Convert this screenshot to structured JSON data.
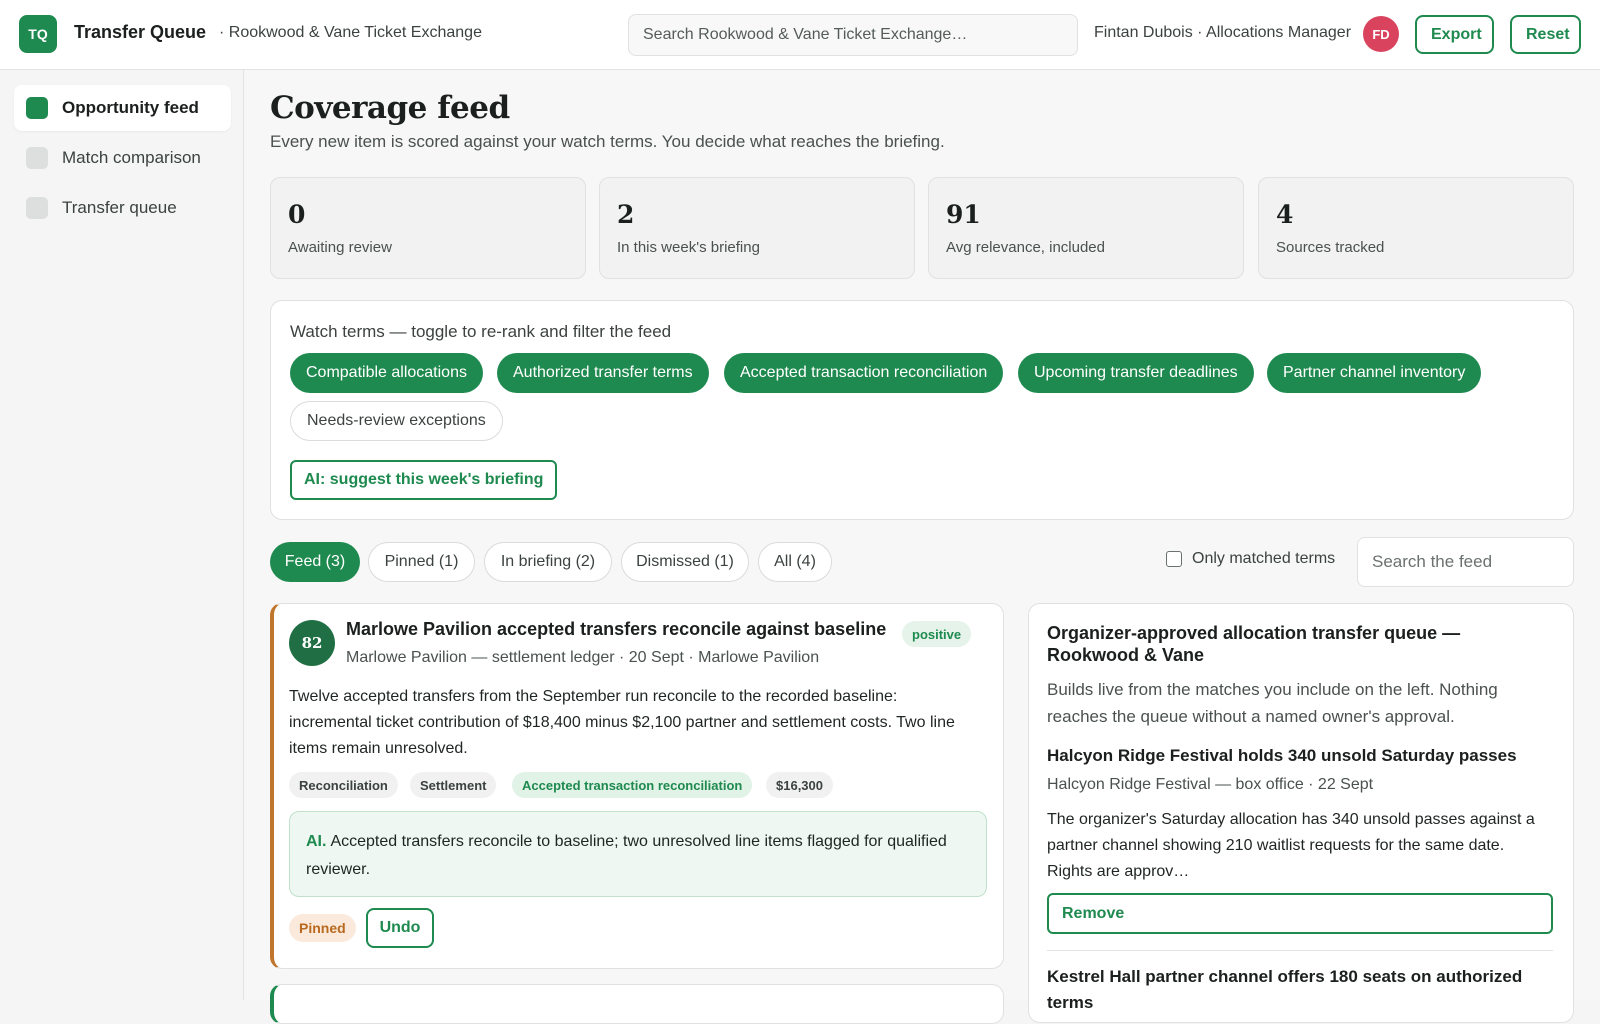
{
  "header": {
    "logo_text": "TQ",
    "app_title": "Transfer Queue",
    "org_name": "· Rookwood & Vane Ticket Exchange",
    "search_placeholder": "Search Rookwood & Vane Ticket Exchange…",
    "user_label": "Fintan Dubois · Allocations Manager",
    "avatar_initials": "FD",
    "export_label": "Export",
    "reset_label": "Reset"
  },
  "sidebar": {
    "items": [
      {
        "label": "Opportunity feed",
        "active": true
      },
      {
        "label": "Match comparison",
        "active": false
      },
      {
        "label": "Transfer queue",
        "active": false
      }
    ]
  },
  "page": {
    "title": "Coverage feed",
    "subtitle": "Every new item is scored against your watch terms. You decide what reaches the briefing."
  },
  "stats": [
    {
      "value": "0",
      "label": "Awaiting review"
    },
    {
      "value": "2",
      "label": "In this week's briefing"
    },
    {
      "value": "91",
      "label": "Avg relevance, included"
    },
    {
      "value": "4",
      "label": "Sources tracked"
    }
  ],
  "watch_terms": {
    "heading": "Watch terms — toggle to re-rank and filter the feed",
    "chips": [
      {
        "label": "Compatible allocations",
        "on": true
      },
      {
        "label": "Authorized transfer terms",
        "on": true
      },
      {
        "label": "Accepted transaction reconciliation",
        "on": true
      },
      {
        "label": "Upcoming transfer deadlines",
        "on": true
      },
      {
        "label": "Partner channel inventory",
        "on": true
      },
      {
        "label": "Needs-review exceptions",
        "on": false
      }
    ],
    "ai_suggest_label": "AI: suggest this week's briefing"
  },
  "tabs": [
    {
      "label": "Feed (3)",
      "active": true
    },
    {
      "label": "Pinned (1)",
      "active": false
    },
    {
      "label": "In briefing (2)",
      "active": false
    },
    {
      "label": "Dismissed (1)",
      "active": false
    },
    {
      "label": "All (4)",
      "active": false
    }
  ],
  "filters": {
    "only_matched_label": "Only matched terms",
    "only_matched_checked": false,
    "feed_search_placeholder": "Search the feed"
  },
  "feed_card": {
    "score": "82",
    "title": "Marlowe Pavilion accepted transfers reconcile against baseline",
    "sentiment": "positive",
    "meta": "Marlowe Pavilion — settlement ledger · 20 Sept · Marlowe Pavilion",
    "body": "Twelve accepted transfers from the September run reconcile to the recorded baseline: incremental ticket contribution of $18,400 minus $2,100 partner and settlement costs. Two line items remain unresolved.",
    "tags": [
      {
        "label": "Reconciliation",
        "match": false
      },
      {
        "label": "Settlement",
        "match": false
      },
      {
        "label": "Accepted transaction reconciliation",
        "match": true
      },
      {
        "label": "$16,300",
        "match": false
      }
    ],
    "ai_prefix": "AI.",
    "ai_text": "Accepted transfers reconcile to baseline; two unresolved line items flagged for qualified reviewer.",
    "pinned_label": "Pinned",
    "undo_label": "Undo",
    "accent_color": "#c0762c"
  },
  "queue_panel": {
    "title": "Organizer-approved allocation transfer queue — Rookwood & Vane",
    "description": "Builds live from the matches you include on the left. Nothing reaches the queue without a named owner's approval.",
    "items": [
      {
        "title": "Halcyon Ridge Festival holds 340 unsold Saturday passes",
        "meta": "Halcyon Ridge Festival — box office · 22 Sept",
        "body": "The organizer's Saturday allocation has 340 unsold passes against a partner channel showing 210 waitlist requests for the same date. Rights are approv…",
        "remove_label": "Remove"
      },
      {
        "title": "Kestrel Hall partner channel offers 180 seats on authorized terms"
      }
    ]
  },
  "colors": {
    "brand": "#1f8a4f",
    "avatar": "#d9435d",
    "pinned": "#b8691f"
  }
}
